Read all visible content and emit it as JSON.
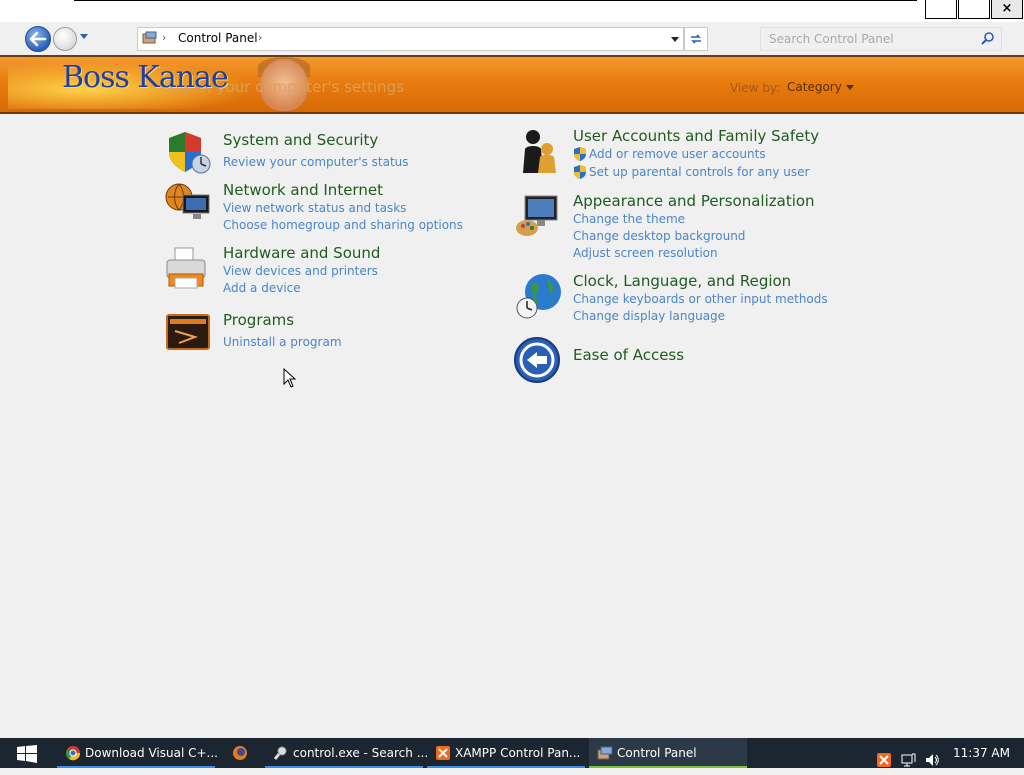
{
  "window": {
    "close_glyph": "×"
  },
  "navbar": {
    "breadcrumb": "Control Panel",
    "search_placeholder": "Search Control Panel"
  },
  "header": {
    "logo_text": "Boss Kanae",
    "tagline": "Adjust your computer's settings",
    "view_by_label": "View by:",
    "view_by_value": "Category"
  },
  "categories_left": [
    {
      "title": "System and Security",
      "links": [
        "Review your computer's status"
      ],
      "icon": "shield-icon"
    },
    {
      "title": "Network and Internet",
      "links": [
        "View network status and tasks",
        "Choose homegroup and sharing options"
      ],
      "icon": "network-globe-icon"
    },
    {
      "title": "Hardware and Sound",
      "links": [
        "View devices and printers",
        "Add a device"
      ],
      "icon": "printer-icon"
    },
    {
      "title": "Programs",
      "links": [
        "Uninstall a program"
      ],
      "icon": "programs-icon"
    }
  ],
  "categories_right": [
    {
      "title": "User Accounts and Family Safety",
      "links": [
        "Add or remove user accounts",
        "Set up parental controls for any user"
      ],
      "icon": "users-icon"
    },
    {
      "title": "Appearance and Personalization",
      "links": [
        "Change the theme",
        "Change desktop background",
        "Adjust screen resolution"
      ],
      "icon": "monitor-paint-icon"
    },
    {
      "title": "Clock, Language, and Region",
      "links": [
        "Change keyboards or other input methods",
        "Change display language"
      ],
      "icon": "globe-clock-icon"
    },
    {
      "title": "Ease of Access",
      "links": [],
      "icon": "ease-of-access-icon"
    }
  ],
  "taskbar": {
    "items": [
      {
        "label": "Download Visual C+...",
        "icon": "chrome-icon"
      },
      {
        "label": "",
        "icon": "firefox-icon"
      },
      {
        "label": "control.exe - Search ...",
        "icon": "search-app-icon"
      },
      {
        "label": "XAMPP Control Pan...",
        "icon": "xampp-icon"
      },
      {
        "label": "Control Panel",
        "icon": "control-panel-icon"
      }
    ],
    "clock": "11:37 AM"
  },
  "colors": {
    "header_orange": "#e87c0f",
    "category_title": "#1e5d1e",
    "link_blue": "#4a86c8",
    "taskbar_bg": "#1b2630"
  }
}
